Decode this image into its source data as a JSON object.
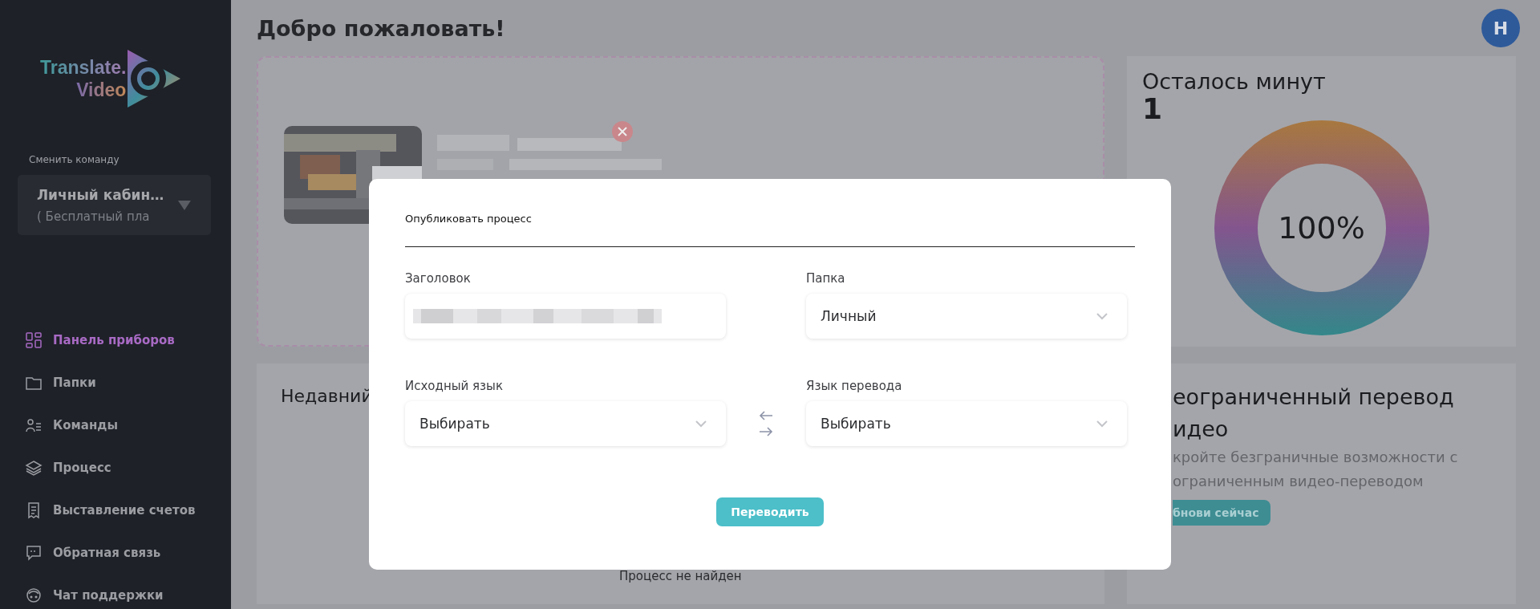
{
  "sidebar": {
    "logo": {
      "line_1": "Translate.",
      "line_2": "Video"
    },
    "team_label": "Сменить команду",
    "team": {
      "name": "Личный кабин…",
      "plan": "( Бесплатный пла"
    },
    "items": [
      {
        "label": "Панель приборов",
        "selected": true
      },
      {
        "label": "Папки",
        "selected": false
      },
      {
        "label": "Команды",
        "selected": false
      },
      {
        "label": "Процесс",
        "selected": false
      },
      {
        "label": "Выставление счетов",
        "selected": false
      },
      {
        "label": "Обратная связь",
        "selected": false
      },
      {
        "label": "Чат поддержки",
        "selected": false
      }
    ]
  },
  "header": {
    "title": "Добро пожаловать!",
    "avatar": "H"
  },
  "minutes_card": {
    "title": "Осталось минут",
    "value": "1",
    "ring": {
      "label": "100%"
    }
  },
  "recent_card": {
    "title": "Недавний",
    "empty": "Процесс не найден"
  },
  "promo_card": {
    "heading": [
      "еограниченный перевод",
      "идео"
    ],
    "text": [
      "кройте безграничные возможности с",
      "ограниченным видео-переводом"
    ],
    "button": "бнови сейчас"
  },
  "modal": {
    "title": "Опубликовать процесс",
    "fields": [
      {
        "label": "Заголовок",
        "kind": "text"
      },
      {
        "label": "Папка",
        "kind": "select",
        "value": "Личный"
      },
      {
        "label": "Исходный язык",
        "kind": "select",
        "value": "Выбирать"
      },
      {
        "label": "Язык перевода",
        "kind": "select",
        "value": "Выбирать"
      }
    ],
    "button": "Переводить"
  }
}
